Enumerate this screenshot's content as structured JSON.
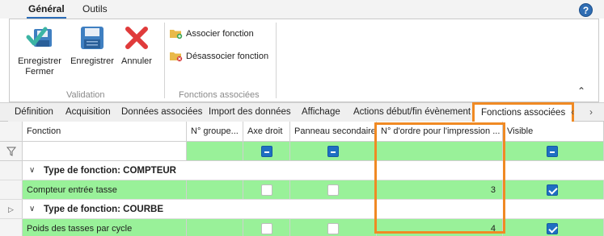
{
  "ribbon_tabs": [
    "Général",
    "Outils"
  ],
  "ribbon": {
    "validation": {
      "save_close": "Enregistrer\nFermer",
      "save": "Enregistrer",
      "cancel": "Annuler",
      "group_label": "Validation"
    },
    "fonctions": {
      "associate": "Associer fonction",
      "dissociate": "Désassocier fonction",
      "group_label": "Fonctions associées"
    },
    "help": "?"
  },
  "page_tabs": [
    "Définition",
    "Acquisition",
    "Données associées",
    "Import des données",
    "Affichage",
    "Actions début/fin évènement",
    "Fonctions associées"
  ],
  "selected_tab": "Fonctions associées",
  "grid": {
    "columns": [
      "Fonction",
      "N° groupe...",
      "Axe droit",
      "Panneau secondaire",
      "N° d'ordre pour l'impression ...",
      "Visible"
    ],
    "groups": [
      {
        "title": "Type de fonction: COMPTEUR",
        "rows": [
          {
            "fonction": "Compteur entrée tasse",
            "groupe": "",
            "axe_droit": false,
            "panneau_secondaire": false,
            "ordre": "3",
            "visible": true
          }
        ]
      },
      {
        "title": "Type de fonction: COURBE",
        "rows": [
          {
            "fonction": "Poids des tasses par cycle",
            "groupe": "",
            "axe_droit": false,
            "panneau_secondaire": false,
            "ordre": "4",
            "visible": true
          }
        ]
      }
    ]
  },
  "colors": {
    "accent": "#2b6cb8",
    "row_green": "#99f199",
    "highlight": "#f08a24",
    "checkbox_blue": "#1f6fc2"
  }
}
